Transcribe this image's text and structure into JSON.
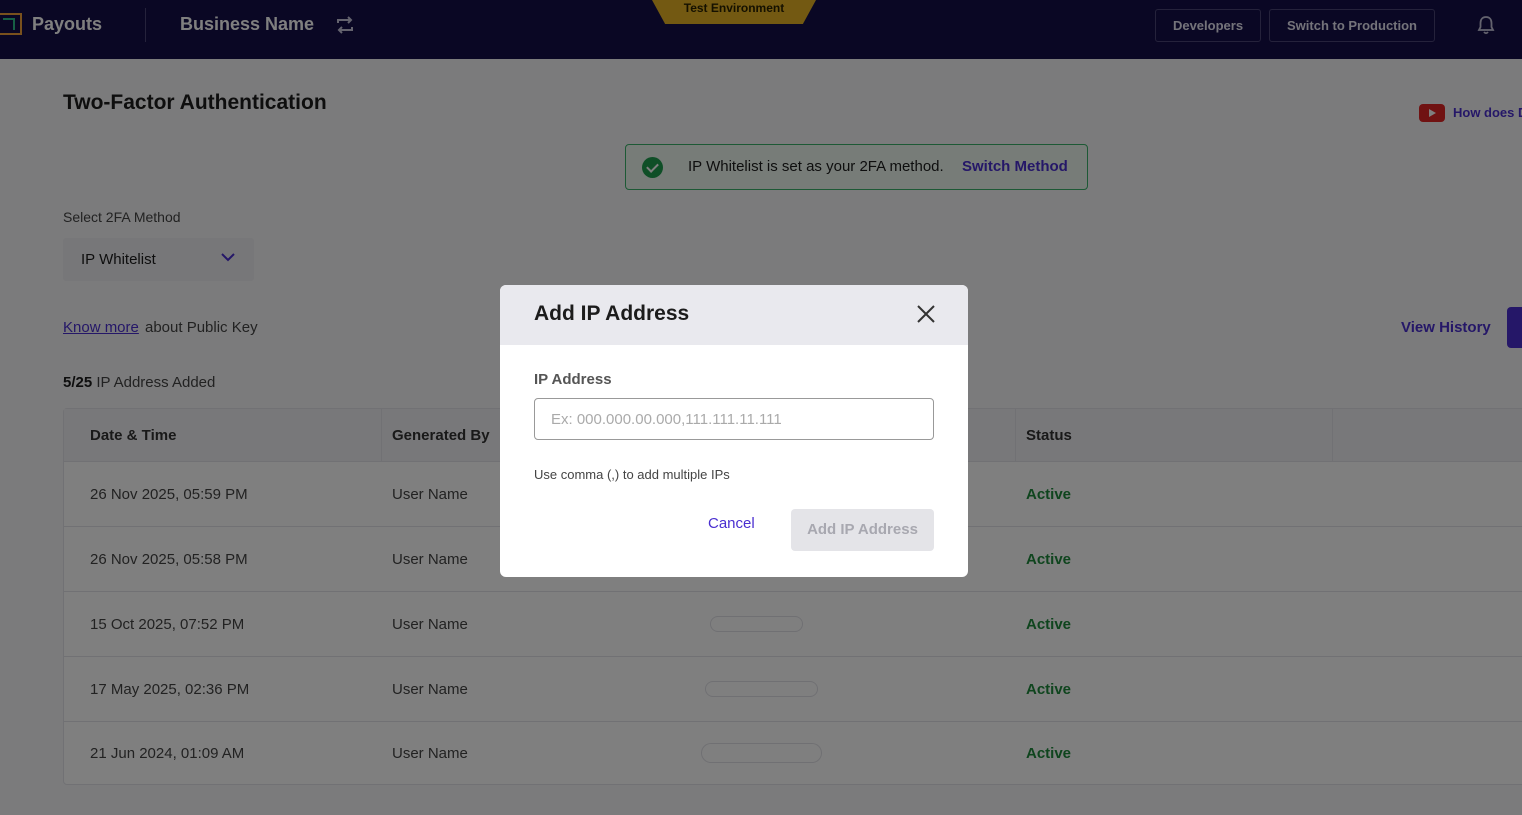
{
  "header": {
    "brand": "Payouts",
    "business_name": "Business Name",
    "environment_badge": "Test Environment",
    "developers_label": "Developers",
    "switch_production_label": "Switch to Production"
  },
  "page": {
    "title": "Two-Factor Authentication",
    "help_video_label": "How does D",
    "banner": {
      "text": "IP Whitelist is set as your 2FA method.",
      "link": "Switch Method"
    },
    "method": {
      "label": "Select 2FA Method",
      "selected": "IP Whitelist"
    },
    "know_more_link": "Know more",
    "know_more_rest": "about Public Key",
    "view_history": "View History",
    "ip_count": "5/25",
    "ip_count_suffix": "IP Address Added"
  },
  "table": {
    "columns": [
      "Date & Time",
      "Generated By",
      "Status"
    ],
    "rows": [
      {
        "datetime": "26 Nov 2025, 05:59 PM",
        "generated_by": "User Name",
        "status": "Active"
      },
      {
        "datetime": "26 Nov 2025, 05:58 PM",
        "generated_by": "User Name",
        "status": "Active"
      },
      {
        "datetime": "15 Oct 2025, 07:52 PM",
        "generated_by": "User Name",
        "status": "Active"
      },
      {
        "datetime": "17 May 2025, 02:36 PM",
        "generated_by": "User Name",
        "status": "Active"
      },
      {
        "datetime": "21 Jun 2024, 01:09 AM",
        "generated_by": "User Name",
        "status": "Active"
      }
    ]
  },
  "modal": {
    "title": "Add IP Address",
    "field_label": "IP Address",
    "placeholder": "Ex: 000.000.00.000,111.111.11.111",
    "value": "",
    "hint": "Use comma (,) to add multiple IPs",
    "cancel_label": "Cancel",
    "submit_label": "Add IP Address"
  },
  "colors": {
    "topbar": "#150f49",
    "accent": "#4a2fd0",
    "success": "#1e8a3d",
    "badge": "#e6b325"
  }
}
